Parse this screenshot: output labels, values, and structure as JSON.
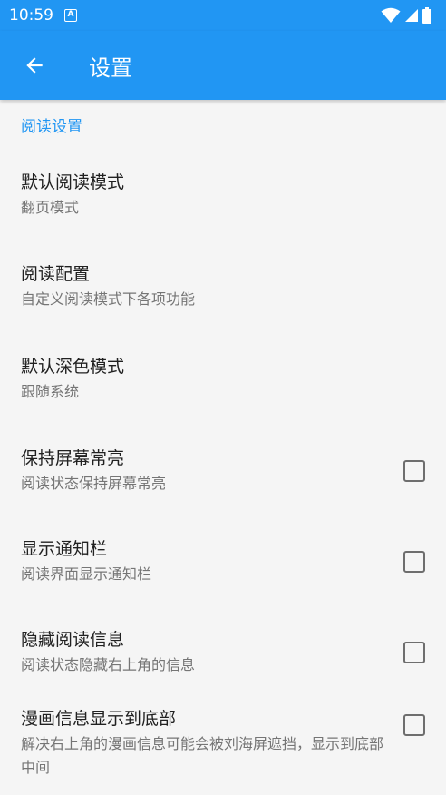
{
  "status_bar": {
    "time": "10:59",
    "notification_icon": "A",
    "icons": [
      "wifi-icon",
      "signal-icon",
      "battery-icon"
    ]
  },
  "app_bar": {
    "title": "设置",
    "back_icon": "arrow-left-icon"
  },
  "section": {
    "header": "阅读设置"
  },
  "preferences": [
    {
      "title": "默认阅读模式",
      "summary": "翻页模式",
      "checkbox": false
    },
    {
      "title": "阅读配置",
      "summary": "自定义阅读模式下各项功能",
      "checkbox": false
    },
    {
      "title": "默认深色模式",
      "summary": "跟随系统",
      "checkbox": false
    },
    {
      "title": "保持屏幕常亮",
      "summary": "阅读状态保持屏幕常亮",
      "checkbox": true,
      "checked": false
    },
    {
      "title": "显示通知栏",
      "summary": "阅读界面显示通知栏",
      "checkbox": true,
      "checked": false
    },
    {
      "title": "隐藏阅读信息",
      "summary": "阅读状态隐藏右上角的信息",
      "checkbox": true,
      "checked": false
    },
    {
      "title": "漫画信息显示到底部",
      "summary": "解决右上角的漫画信息可能会被刘海屏遮挡，显示到底部中间",
      "checkbox": true,
      "checked": false
    }
  ],
  "colors": {
    "primary": "#2196f3",
    "background": "#f5f5f5",
    "title_text": "#212121",
    "summary_text": "#757575"
  }
}
